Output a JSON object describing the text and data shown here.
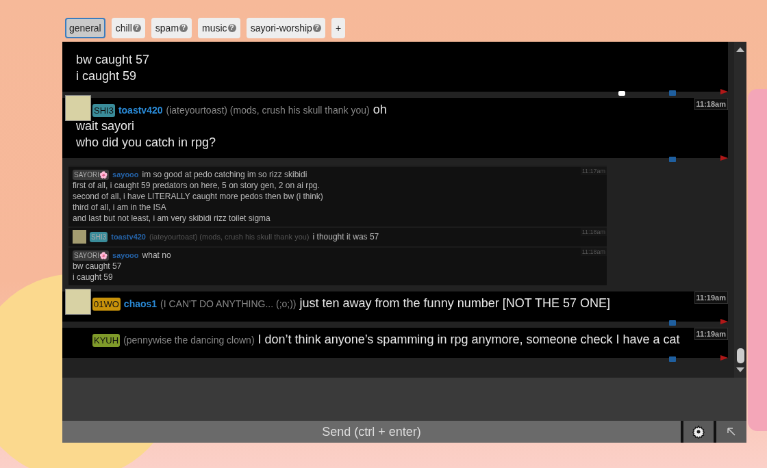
{
  "tabs": [
    {
      "label": "general",
      "selected": true
    },
    {
      "label": "chill",
      "selected": false,
      "help": "?"
    },
    {
      "label": "spam",
      "selected": false,
      "help": "?"
    },
    {
      "label": "music",
      "selected": false,
      "help": "?"
    },
    {
      "label": "sayori-worship",
      "selected": false,
      "help": "?"
    },
    {
      "label": "+",
      "selected": false
    }
  ],
  "messages": [
    {
      "kind": "full",
      "avatar": false,
      "lines": [
        "bw caught 57",
        "i caught 59"
      ],
      "more": true
    },
    {
      "kind": "full",
      "avatar": true,
      "badge": "SHI3",
      "color": "#3a8c9a",
      "name": "toastv420",
      "tagline": "(iateyourtoast) (mods, crush his skull thank you)",
      "first": "oh",
      "lines": [
        "wait sayori",
        "who did you catch in rpg?"
      ],
      "time": "11:18am"
    },
    {
      "kind": "compact",
      "avatar": false,
      "badge": "SAYORI🌸",
      "color": "#3a3a3a",
      "name": "sayooo",
      "first": "im so good at pedo catching im so rizz skibidi",
      "lines": [
        "first of all, i caught 59 predators on here, 5 on story gen, 2 on ai rpg.",
        "second of all, i have LITERALLY caught more pedos then bw (i think)",
        "third of all, i am in the ISA",
        "and last but not least, i am very skibidi rizz toilet sigma"
      ],
      "time": "11:17am"
    },
    {
      "kind": "compact",
      "avatar": true,
      "badge": "SHI3",
      "color": "#3a8c9a",
      "name": "toastv420",
      "tagline": "(iateyourtoast) (mods, crush his skull thank you)",
      "first": "i thought it was 57",
      "time": "11:18am"
    },
    {
      "kind": "compact",
      "avatar": false,
      "badge": "SAYORI🌸",
      "color": "#3a3a3a",
      "name": "sayooo",
      "first": "what no",
      "lines": [
        "bw caught 57",
        "i caught 59"
      ],
      "time": "11:18am"
    },
    {
      "kind": "full",
      "avatar": true,
      "badge": "01WO",
      "color": "#c8920a",
      "name": "chaos1",
      "tagline": "(I CAN'T DO ANYTHING... (;o;))",
      "first": "just ten away from the funny number [NOT THE 57 ONE]",
      "time": "11:19am"
    },
    {
      "kind": "full",
      "avatar": false,
      "badge": "KYUH",
      "color": "#7f9a2a",
      "tagline": "(pennywise the dancing clown)",
      "first": "I don’t think anyone’s spamming in rpg anymore, someone check I have a cat",
      "time": "11:19am"
    }
  ],
  "send": {
    "label": "Send (ctrl + enter)"
  }
}
